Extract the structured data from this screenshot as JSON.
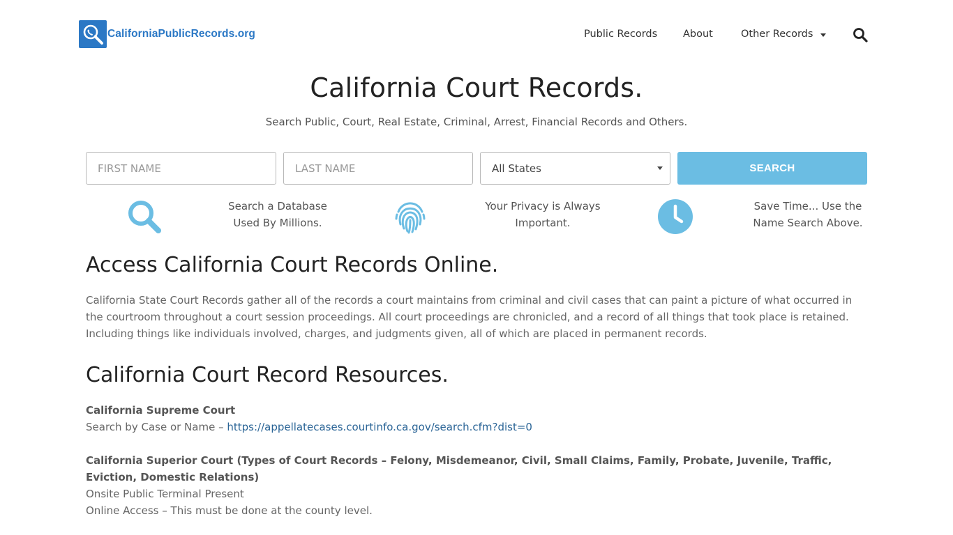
{
  "header": {
    "logo_text": "CaliforniaPublicRecords.org",
    "nav": {
      "public_records": "Public Records",
      "about": "About",
      "other_records": "Other Records"
    }
  },
  "hero": {
    "title": "California Court Records.",
    "subtitle": "Search Public, Court, Real Estate, Criminal, Arrest, Financial Records and Others."
  },
  "search_form": {
    "first_name_placeholder": "FIRST NAME",
    "last_name_placeholder": "LAST NAME",
    "state_selected": "All States",
    "search_label": "SEARCH"
  },
  "features": [
    {
      "icon": "magnifier-icon",
      "line1": "Search a Database",
      "line2": "Used By Millions."
    },
    {
      "icon": "fingerprint-icon",
      "line1": "Your Privacy is Always",
      "line2": "Important."
    },
    {
      "icon": "clock-icon",
      "line1": "Save Time... Use the",
      "line2": "Name Search Above."
    }
  ],
  "access_section": {
    "heading": "Access California Court Records Online.",
    "body": "California State Court Records gather all of the records a court maintains from criminal and civil cases that can paint a picture of what occurred in the courtroom throughout a court session proceedings. All court proceedings are chronicled, and a record of all things that took place is retained. Including things like individuals involved, charges, and judgments given, all of which are placed in permanent records."
  },
  "resources_section": {
    "heading": "California Court Record Resources.",
    "supreme": {
      "title": "California Supreme Court",
      "prefix": "Search by Case or Name – ",
      "link": "https://appellatecases.courtinfo.ca.gov/search.cfm?dist=0"
    },
    "superior": {
      "title": "California Superior Court (Types of Court Records – Felony, Misdemeanor, Civil, Small Claims, Family, Probate, Juvenile, Traffic, Eviction, Domestic Relations)",
      "line1": "Onsite Public Terminal Present",
      "line2": "Online Access – This must be done at the county level."
    }
  },
  "colors": {
    "brand_blue": "#2b78c5",
    "accent_light_blue": "#6bbde3",
    "link_blue": "#2a6496"
  }
}
